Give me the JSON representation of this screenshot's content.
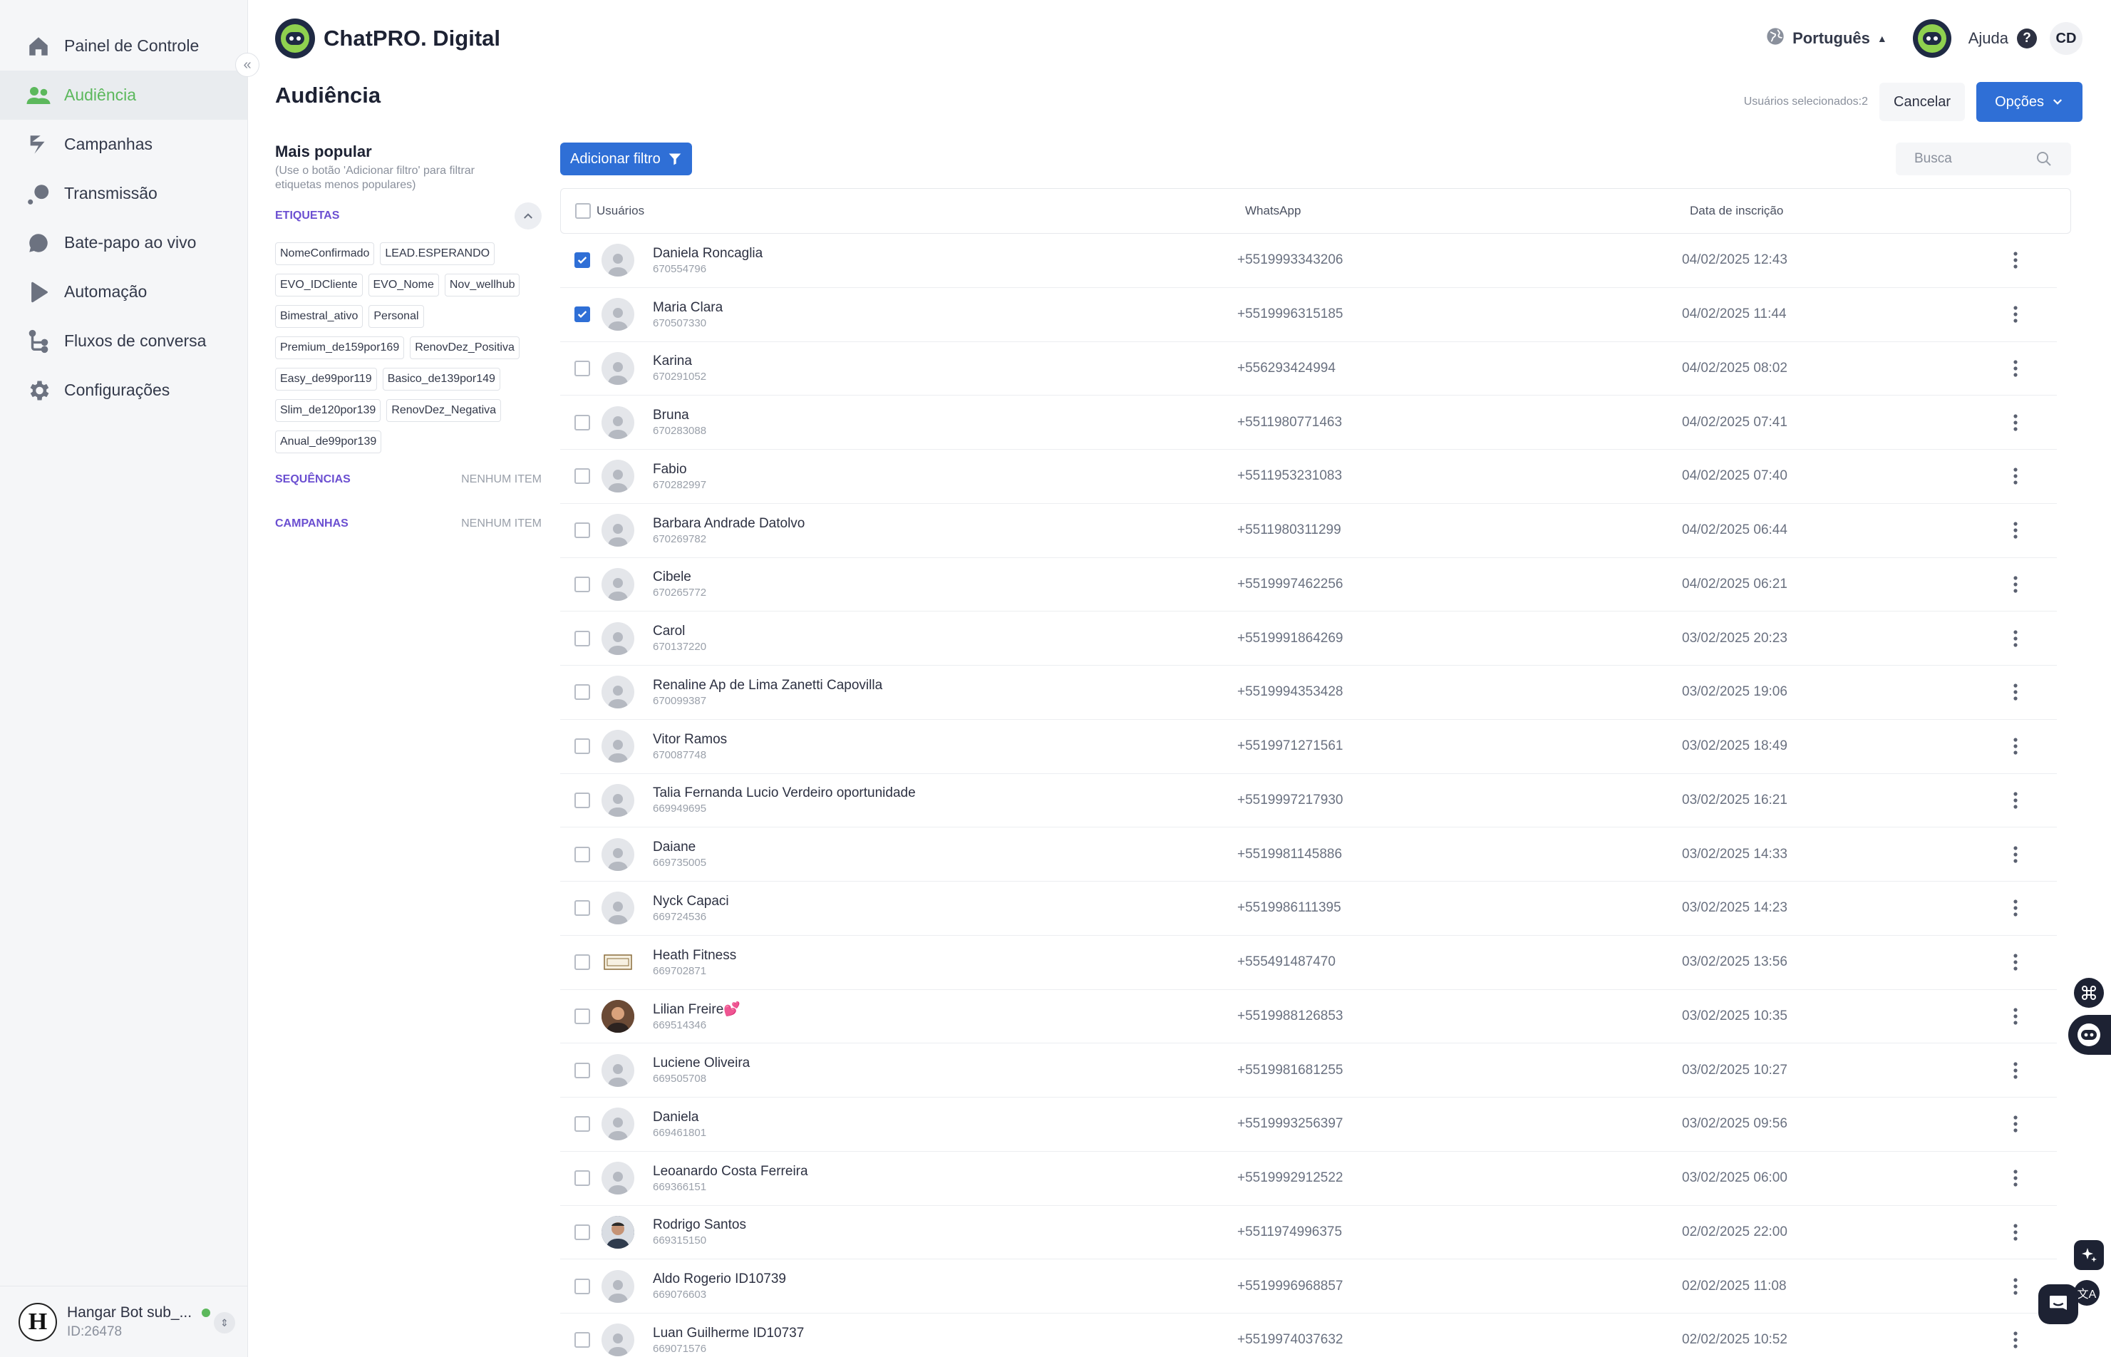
{
  "sidebar": {
    "items": [
      {
        "label": "Painel de Controle",
        "icon": "home-icon"
      },
      {
        "label": "Audiência",
        "icon": "users-icon",
        "active": true
      },
      {
        "label": "Campanhas",
        "icon": "campaigns-icon"
      },
      {
        "label": "Transmissão",
        "icon": "broadcast-icon"
      },
      {
        "label": "Bate-papo ao vivo",
        "icon": "chat-icon"
      },
      {
        "label": "Automação",
        "icon": "play-icon"
      },
      {
        "label": "Fluxos de conversa",
        "icon": "flow-icon"
      },
      {
        "label": "Configurações",
        "icon": "gear-icon"
      }
    ],
    "account": {
      "logo_letter": "H",
      "name": "Hangar Bot sub_...",
      "id": "ID:26478"
    }
  },
  "header": {
    "brand": "ChatPRO. Digital",
    "language": "Português",
    "help": "Ajuda",
    "initials": "CD"
  },
  "page": {
    "title": "Audiência",
    "selected_text": "Usuários selecionados:2",
    "cancel_label": "Cancelar",
    "options_label": "Opções"
  },
  "filters": {
    "title": "Mais popular",
    "hint": "(Use o botão 'Adicionar filtro' para filtrar etiquetas menos populares)",
    "tags_title": "ETIQUETAS",
    "tags": [
      "NomeConfirmado",
      "LEAD.ESPERANDO",
      "EVO_IDCliente",
      "EVO_Nome",
      "Nov_wellhub",
      "Bimestral_ativo",
      "Personal",
      "Premium_de159por169",
      "RenovDez_Positiva",
      "Easy_de99por119",
      "Basico_de139por149",
      "Slim_de120por139",
      "RenovDez_Negativa",
      "Anual_de99por139"
    ],
    "sequences_title": "SEQUÊNCIAS",
    "sequences_empty": "NENHUM ITEM",
    "campaigns_title": "CAMPANHAS",
    "campaigns_empty": "NENHUM ITEM"
  },
  "toolbar": {
    "add_filter_label": "Adicionar filtro",
    "search_placeholder": "Busca"
  },
  "table": {
    "headers": {
      "users": "Usuários",
      "whatsapp": "WhatsApp",
      "date": "Data de inscrição"
    },
    "rows": [
      {
        "name": "Daniela Roncaglia",
        "id": "670554796",
        "phone": "+5519993343206",
        "date": "04/02/2025 12:43",
        "checked": true,
        "avatar": "default"
      },
      {
        "name": "Maria Clara",
        "id": "670507330",
        "phone": "+5519996315185",
        "date": "04/02/2025 11:44",
        "checked": true,
        "avatar": "default"
      },
      {
        "name": "Karina",
        "id": "670291052",
        "phone": "+556293424994",
        "date": "04/02/2025 08:02",
        "checked": false,
        "avatar": "default"
      },
      {
        "name": "Bruna",
        "id": "670283088",
        "phone": "+5511980771463",
        "date": "04/02/2025 07:41",
        "checked": false,
        "avatar": "default"
      },
      {
        "name": "Fabio",
        "id": "670282997",
        "phone": "+5511953231083",
        "date": "04/02/2025 07:40",
        "checked": false,
        "avatar": "default"
      },
      {
        "name": "Barbara Andrade Datolvo",
        "id": "670269782",
        "phone": "+5511980311299",
        "date": "04/02/2025 06:44",
        "checked": false,
        "avatar": "default"
      },
      {
        "name": "Cibele",
        "id": "670265772",
        "phone": "+5519997462256",
        "date": "04/02/2025 06:21",
        "checked": false,
        "avatar": "default"
      },
      {
        "name": "Carol",
        "id": "670137220",
        "phone": "+5519991864269",
        "date": "03/02/2025 20:23",
        "checked": false,
        "avatar": "default"
      },
      {
        "name": "Renaline Ap de Lima Zanetti Capovilla",
        "id": "670099387",
        "phone": "+5519994353428",
        "date": "03/02/2025 19:06",
        "checked": false,
        "avatar": "default"
      },
      {
        "name": "Vitor Ramos",
        "id": "670087748",
        "phone": "+5519971271561",
        "date": "03/02/2025 18:49",
        "checked": false,
        "avatar": "default"
      },
      {
        "name": "Talia Fernanda Lucio Verdeiro oportunidade",
        "id": "669949695",
        "phone": "+5519997217930",
        "date": "03/02/2025 16:21",
        "checked": false,
        "avatar": "default"
      },
      {
        "name": "Daiane",
        "id": "669735005",
        "phone": "+5519981145886",
        "date": "03/02/2025 14:33",
        "checked": false,
        "avatar": "default"
      },
      {
        "name": "Nyck Capaci",
        "id": "669724536",
        "phone": "+5519986111395",
        "date": "03/02/2025 14:23",
        "checked": false,
        "avatar": "default"
      },
      {
        "name": "Heath Fitness",
        "id": "669702871",
        "phone": "+555491487470",
        "date": "03/02/2025 13:56",
        "checked": false,
        "avatar": "brand"
      },
      {
        "name": "Lilian Freire💕",
        "id": "669514346",
        "phone": "+5519988126853",
        "date": "03/02/2025 10:35",
        "checked": false,
        "avatar": "photo1"
      },
      {
        "name": "Luciene Oliveira",
        "id": "669505708",
        "phone": "+5519981681255",
        "date": "03/02/2025 10:27",
        "checked": false,
        "avatar": "default"
      },
      {
        "name": "Daniela",
        "id": "669461801",
        "phone": "+5519993256397",
        "date": "03/02/2025 09:56",
        "checked": false,
        "avatar": "default"
      },
      {
        "name": "Leoanardo Costa Ferreira",
        "id": "669366151",
        "phone": "+5519992912522",
        "date": "03/02/2025 06:00",
        "checked": false,
        "avatar": "default"
      },
      {
        "name": "Rodrigo Santos",
        "id": "669315150",
        "phone": "+5511974996375",
        "date": "02/02/2025 22:00",
        "checked": false,
        "avatar": "photo2"
      },
      {
        "name": "Aldo Rogerio ID10739",
        "id": "669076603",
        "phone": "+5519996968857",
        "date": "02/02/2025 11:08",
        "checked": false,
        "avatar": "default"
      },
      {
        "name": "Luan Guilherme ID10737",
        "id": "669071576",
        "phone": "+5519974037632",
        "date": "02/02/2025 10:52",
        "checked": false,
        "avatar": "default"
      }
    ]
  },
  "colors": {
    "accent": "#2f6fd6",
    "active_nav": "#5cb85c",
    "section": "#6b4fd1"
  }
}
